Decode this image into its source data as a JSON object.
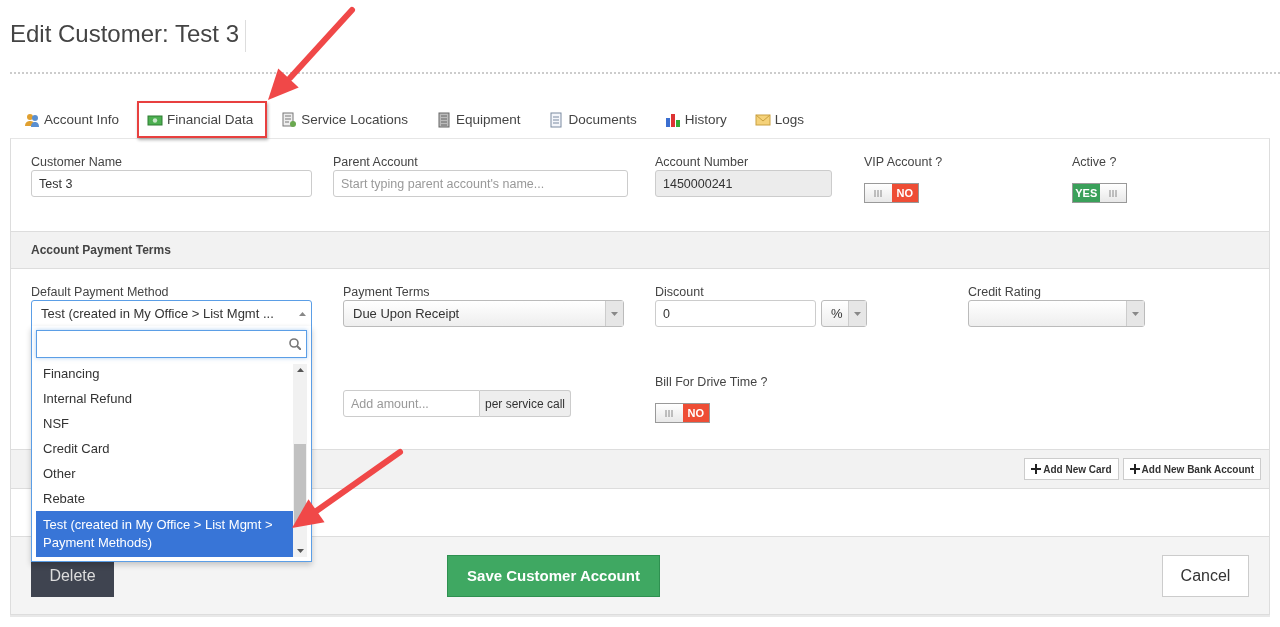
{
  "page": {
    "title": "Edit Customer: Test 3"
  },
  "tabs": [
    {
      "label": "Account Info",
      "highlighted": false
    },
    {
      "label": "Financial Data",
      "highlighted": true
    },
    {
      "label": "Service Locations",
      "highlighted": false
    },
    {
      "label": "Equipment",
      "highlighted": false
    },
    {
      "label": "Documents",
      "highlighted": false
    },
    {
      "label": "History",
      "highlighted": false
    },
    {
      "label": "Logs",
      "highlighted": false
    }
  ],
  "account": {
    "fields": [
      {
        "kind": "text",
        "label": "Customer Name",
        "value": "Test 3"
      },
      {
        "kind": "text",
        "label": "Parent Account",
        "placeholder": "Start typing parent account's name..."
      },
      {
        "kind": "readonly",
        "label": "Account Number",
        "value": "1450000241"
      },
      {
        "kind": "toggle",
        "label": "VIP Account ?",
        "on": false,
        "text": "NO"
      },
      {
        "kind": "toggle",
        "label": "Active ?",
        "on": true,
        "text": "YES"
      }
    ]
  },
  "payment_terms": {
    "heading": "Account Payment Terms",
    "fields": [
      {
        "kind": "select",
        "label": "Default Payment Method",
        "value": "Test (created in My Office > List Mgmt ...",
        "expanded": true
      },
      {
        "kind": "select",
        "label": "Payment Terms",
        "value": "Due Upon Receipt",
        "expanded": false
      },
      {
        "kind": "number_unit",
        "label": "Discount",
        "value": "0",
        "unit": "%"
      },
      {
        "kind": "select",
        "label": "Credit Rating",
        "expanded": false
      },
      {
        "kind": "empty"
      },
      {
        "kind": "amount",
        "placeholder": "Add amount...",
        "addon": "per service call"
      },
      {
        "kind": "toggle",
        "label": "Bill For Drive Time ?",
        "on": false,
        "text": "NO"
      }
    ],
    "dropdown_options": [
      {
        "label": "Financing",
        "selected": false
      },
      {
        "label": "Internal Refund",
        "selected": false
      },
      {
        "label": "NSF",
        "selected": false
      },
      {
        "label": "Credit Card",
        "selected": false
      },
      {
        "label": "Other",
        "selected": false
      },
      {
        "label": "Rebate",
        "selected": false
      },
      {
        "label": "Test (created in My Office > List Mgmt > Payment Methods)",
        "selected": true
      }
    ]
  },
  "cards_bar": {
    "buttons": [
      "Add New Card",
      "Add New Bank Account"
    ]
  },
  "footer": {
    "delete": "Delete",
    "save": "Save Customer Account",
    "cancel": "Cancel"
  }
}
